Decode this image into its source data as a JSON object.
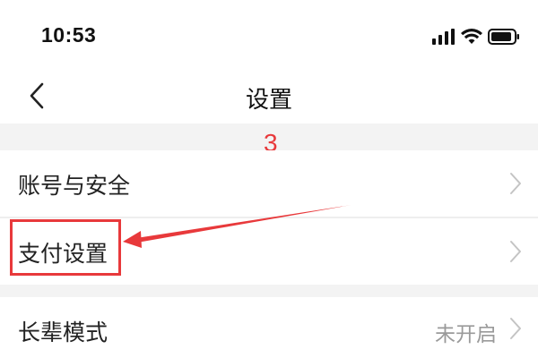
{
  "status_bar": {
    "time": "10:53",
    "icons": [
      "signal-icon",
      "wifi-icon",
      "battery-icon"
    ]
  },
  "nav": {
    "back_icon": "chevron-left-icon",
    "title": "设置"
  },
  "annotation": {
    "step_number": "3",
    "color": "#e8393b",
    "highlighted_item": "支付设置"
  },
  "settings": {
    "group1": [
      {
        "label": "账号与安全",
        "chevron_icon": "chevron-right-icon"
      },
      {
        "label": "支付设置",
        "chevron_icon": "chevron-right-icon"
      }
    ],
    "group2": [
      {
        "label": "长辈模式",
        "value": "未开启",
        "chevron_icon": "chevron-right-icon"
      }
    ]
  },
  "colors": {
    "background": "#ffffff",
    "section_gap": "#f3f3f3",
    "text_primary": "#222222",
    "text_secondary": "#9a9a9a",
    "chevron": "#c4c4c4",
    "annotation": "#e8393b"
  }
}
